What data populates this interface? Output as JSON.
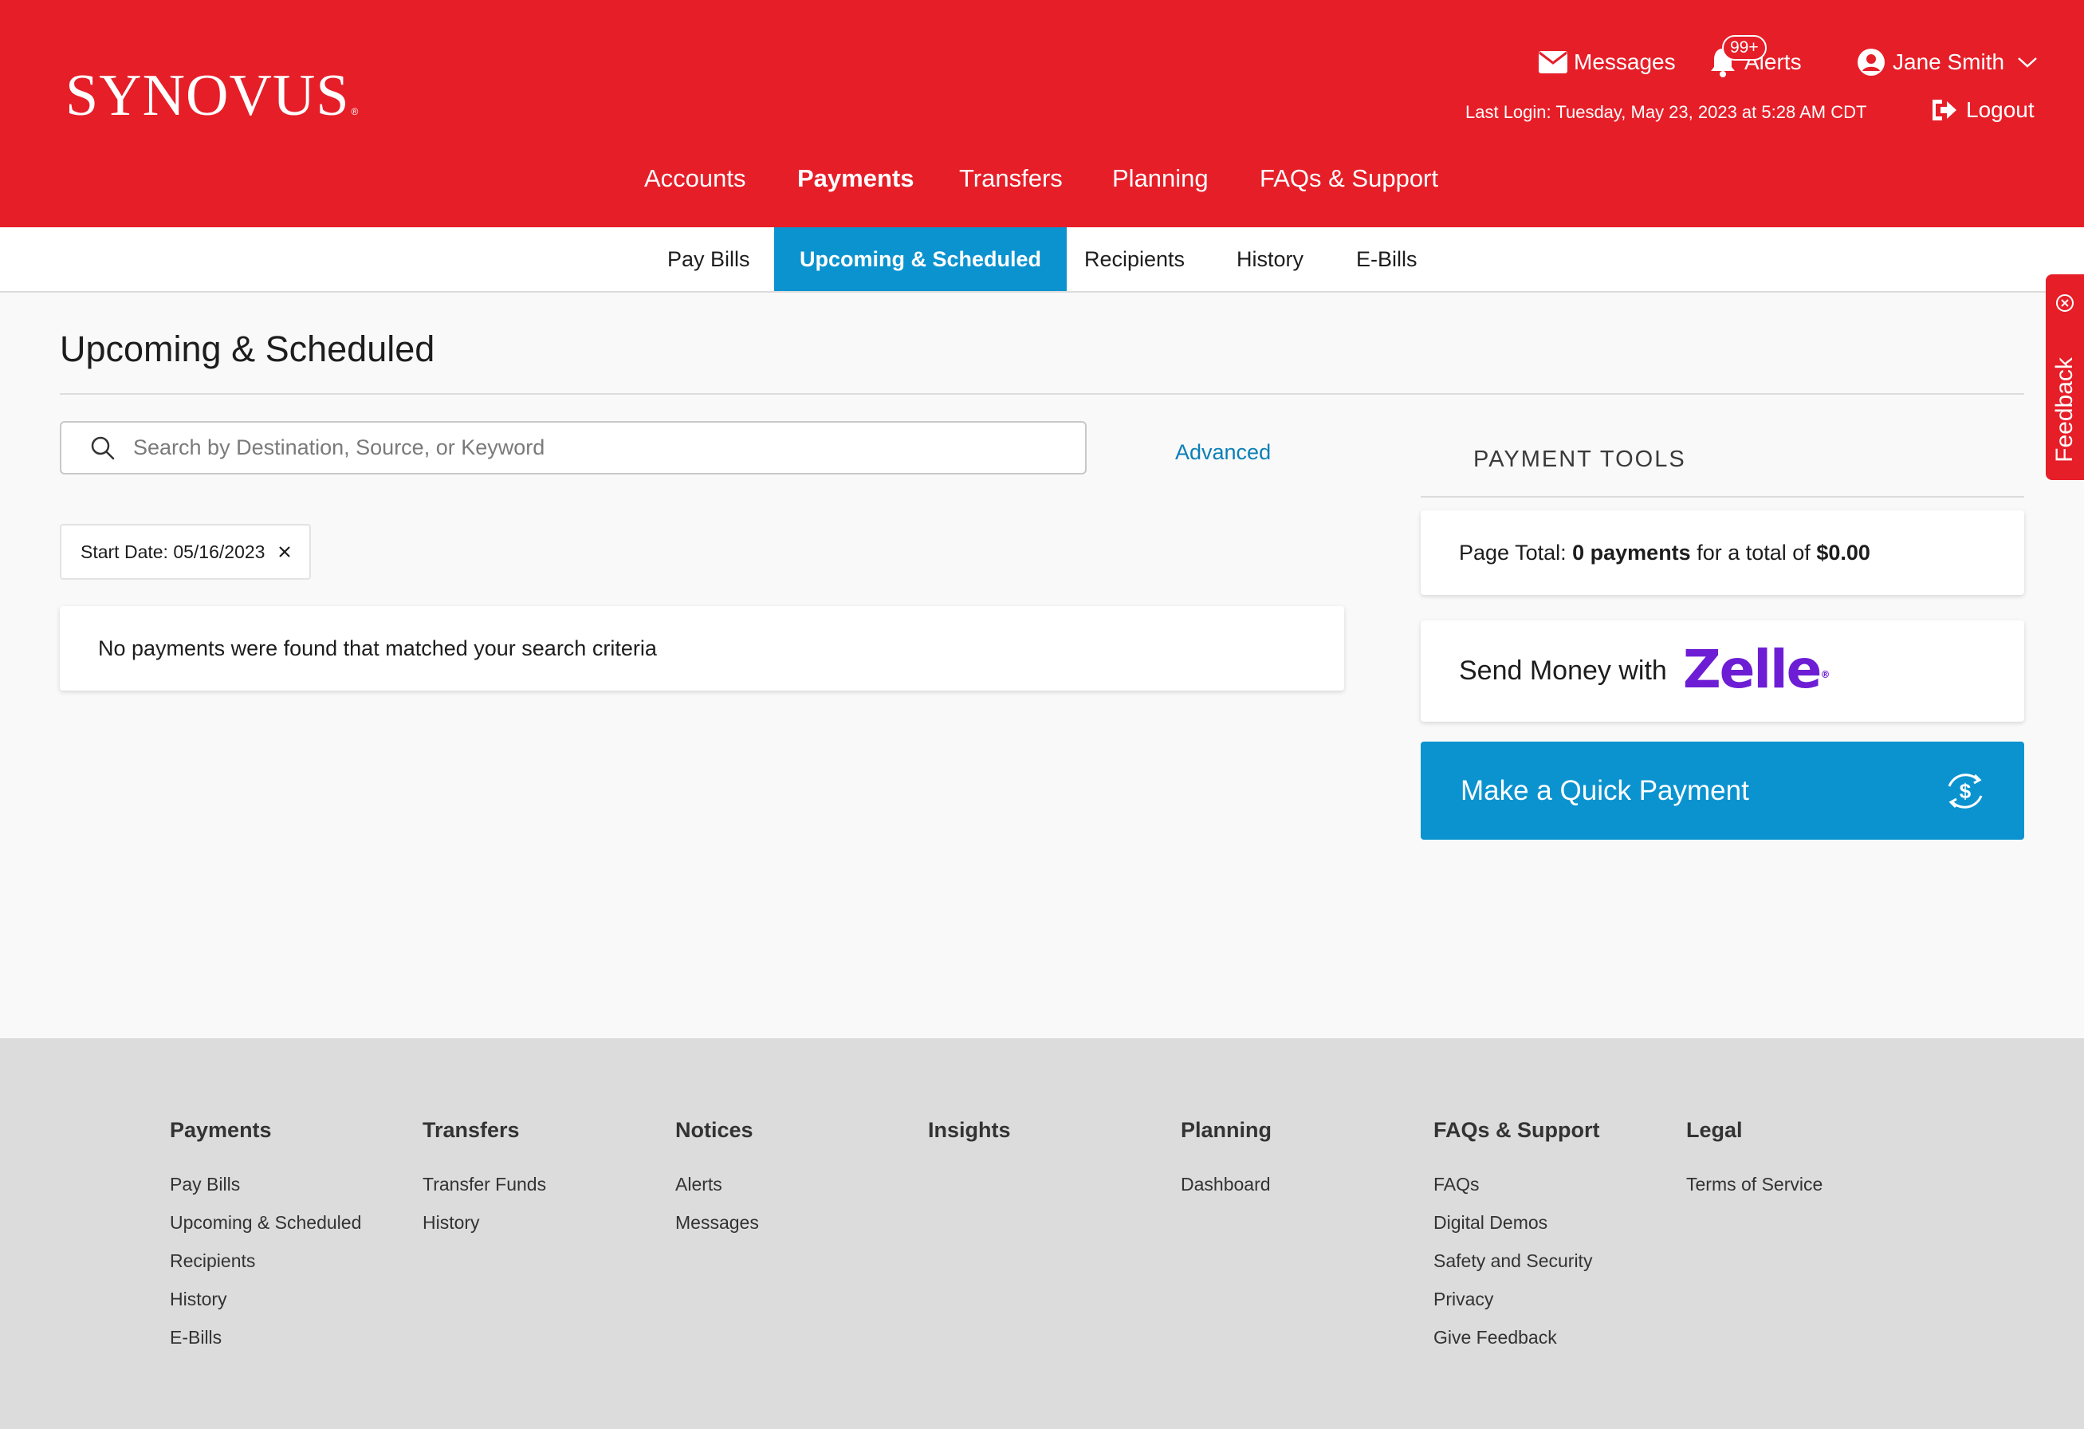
{
  "header": {
    "logo_text": "SYNOVUS",
    "logo_reg": "®",
    "messages_label": "Messages",
    "alerts_label": "Alerts",
    "alerts_badge": "99+",
    "user_name": "Jane Smith",
    "last_login": "Last Login: Tuesday, May 23, 2023 at 5:28 AM CDT",
    "logout_label": "Logout",
    "brand_color": "#e61e28"
  },
  "main_nav": {
    "items": [
      "Accounts",
      "Payments",
      "Transfers",
      "Planning",
      "FAQs & Support"
    ],
    "active": "Payments"
  },
  "sub_nav": {
    "tabs": [
      "Pay Bills",
      "Upcoming & Scheduled",
      "Recipients",
      "History",
      "E-Bills"
    ],
    "active": "Upcoming & Scheduled",
    "active_color": "#0b93d0"
  },
  "feedback": {
    "label": "Feedback"
  },
  "page": {
    "title": "Upcoming & Scheduled",
    "search_placeholder": "Search by Destination, Source, or Keyword",
    "search_value": "",
    "advanced_label": "Advanced",
    "filter_chip": "Start Date: 05/16/2023",
    "empty_message": "No payments were found that matched your search criteria"
  },
  "payment_tools": {
    "title": "PAYMENT TOOLS",
    "page_total_prefix": "Page Total:",
    "page_total_count": "0 payments",
    "page_total_mid": "for a total of",
    "page_total_amount": "$0.00",
    "send_money_label": "Send Money with",
    "zelle_logo": "Zelle",
    "zelle_reg": "®",
    "quick_payment_label": "Make a Quick Payment"
  },
  "footer": {
    "columns": [
      {
        "heading": "Payments",
        "links": [
          "Pay Bills",
          "Upcoming & Scheduled",
          "Recipients",
          "History",
          "E-Bills"
        ]
      },
      {
        "heading": "Transfers",
        "links": [
          "Transfer Funds",
          "History"
        ]
      },
      {
        "heading": "Notices",
        "links": [
          "Alerts",
          "Messages"
        ]
      },
      {
        "heading": "Insights",
        "links": []
      },
      {
        "heading": "Planning",
        "links": [
          "Dashboard"
        ]
      },
      {
        "heading": "FAQs & Support",
        "links": [
          "FAQs",
          "Digital Demos",
          "Safety and Security",
          "Privacy",
          "Give Feedback"
        ]
      },
      {
        "heading": "Legal",
        "links": [
          "Terms of Service"
        ]
      }
    ]
  },
  "icons": {
    "messages": "envelope-icon",
    "alerts": "bell-icon",
    "user": "user-circle-icon",
    "user_menu": "chevron-down-icon",
    "logout": "logout-icon",
    "search": "search-icon",
    "chip_remove": "close-icon",
    "feedback_close": "close-circle-icon",
    "quick_payment": "dollar-refresh-icon"
  }
}
